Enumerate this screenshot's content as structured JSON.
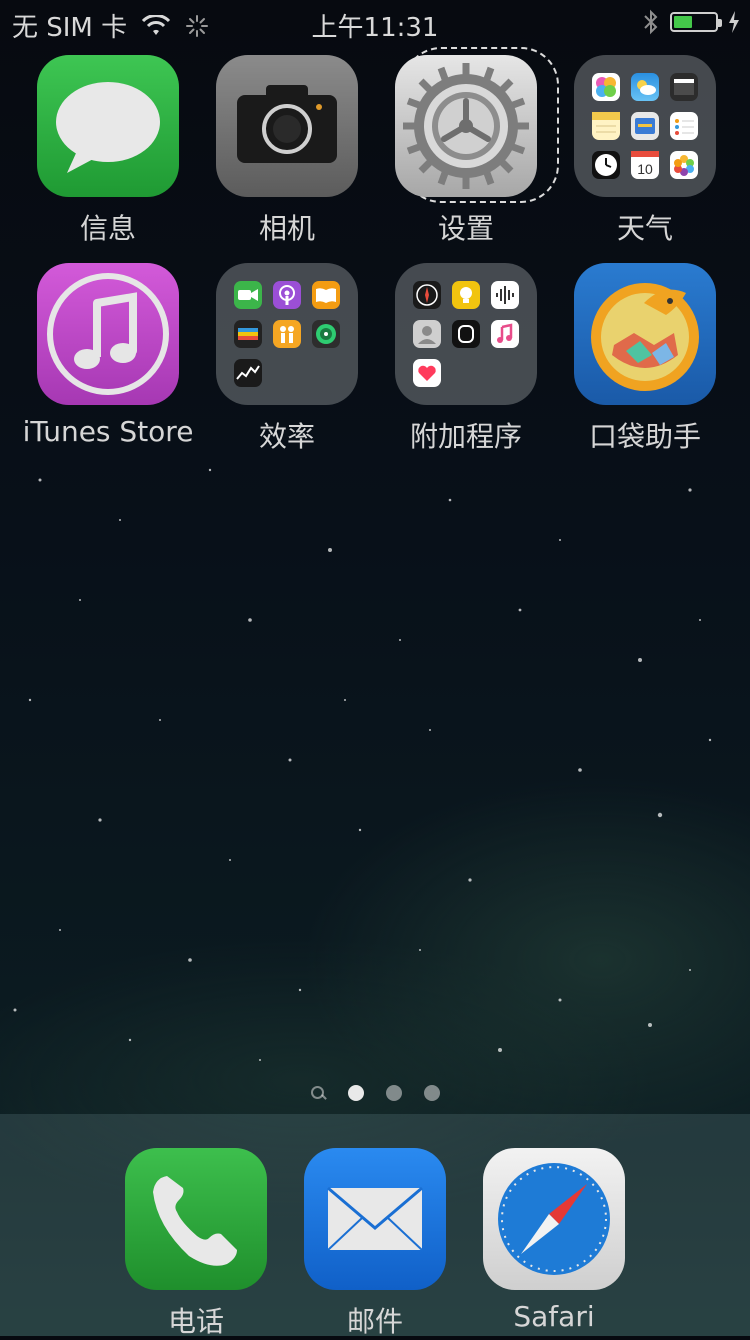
{
  "status_bar": {
    "carrier": "无 SIM 卡",
    "time": "上午11:31",
    "battery_level": 0.45,
    "colors": {
      "battery": "#44c84a"
    }
  },
  "apps": [
    {
      "label": "信息",
      "icon": "messages-icon"
    },
    {
      "label": "相机",
      "icon": "camera-icon"
    },
    {
      "label": "设置",
      "icon": "settings-gear-icon",
      "selected": true
    },
    {
      "label": "天气",
      "icon": "folder-icon"
    },
    {
      "label": "iTunes Store",
      "icon": "itunes-store-icon"
    },
    {
      "label": "效率",
      "icon": "folder-icon"
    },
    {
      "label": "附加程序",
      "icon": "folder-icon"
    },
    {
      "label": "口袋助手",
      "icon": "pocket-assistant-icon"
    }
  ],
  "page_indicator": {
    "pages": 3,
    "current": 1,
    "has_spotlight": true
  },
  "dock": [
    {
      "label": "电话",
      "icon": "phone-icon"
    },
    {
      "label": "邮件",
      "icon": "mail-icon"
    },
    {
      "label": "Safari",
      "icon": "safari-icon"
    }
  ],
  "colors": {
    "messages": "#2fb344",
    "itunes": "#c441c9",
    "phone": "#2ea43a",
    "mail": "#1f7fe0"
  }
}
